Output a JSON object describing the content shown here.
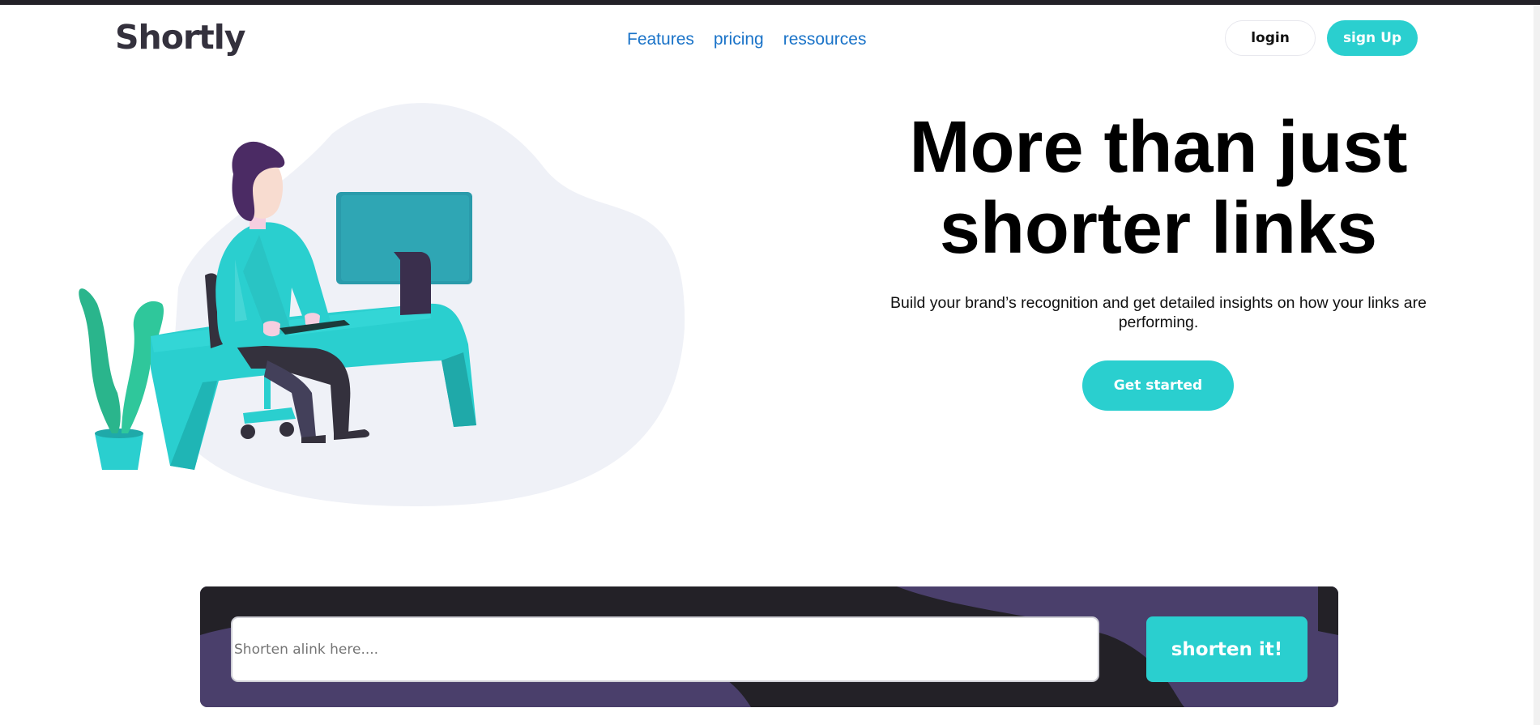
{
  "header": {
    "logo": "Shortly",
    "nav": [
      {
        "label": "Features"
      },
      {
        "label": "pricing"
      },
      {
        "label": "ressources"
      }
    ],
    "login_label": "login",
    "signup_label": "sign Up"
  },
  "hero": {
    "title_line1": "More than just",
    "title_line2": "shorter links",
    "subtitle": "Build your brand’s recognition and get detailed insights on how your links are performing.",
    "cta_label": "Get started",
    "illustration_icon": "person-working-at-desk-illustration"
  },
  "shorten": {
    "placeholder": "Shorten alink here....",
    "value": "",
    "button_label": "shorten it!"
  },
  "colors": {
    "accent": "#2acfcf",
    "dark_violet": "#3b3054",
    "nav_link": "#1a73c8",
    "blob": "#eff1f7"
  }
}
